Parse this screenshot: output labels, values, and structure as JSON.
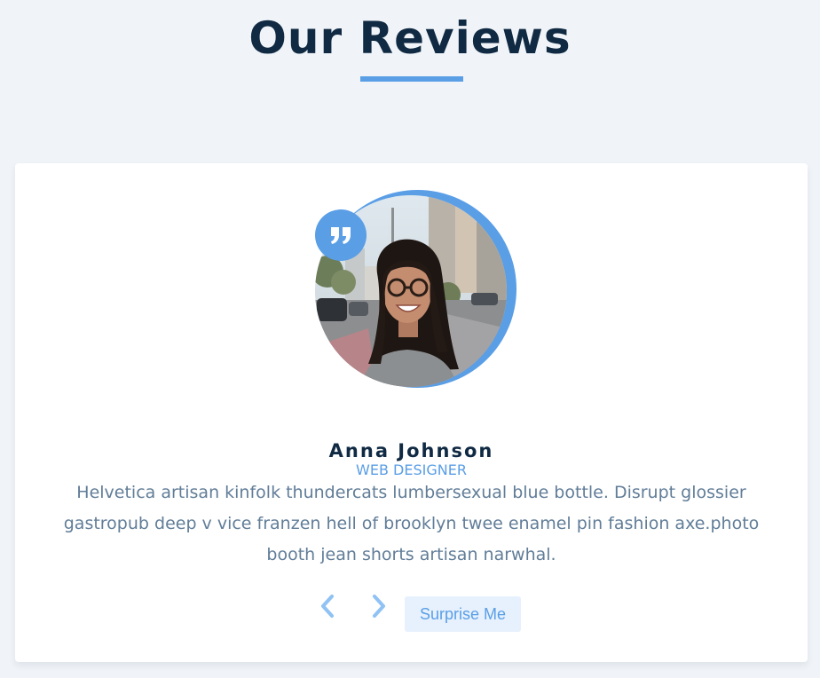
{
  "header": {
    "title": "Our Reviews"
  },
  "review": {
    "name": "Anna Johnson",
    "job": "WEB DESIGNER",
    "text": "Helvetica artisan kinfolk thundercats lumbersexual blue bottle. Disrupt glossier gastropub deep v vice franzen hell of brooklyn twee enamel pin fashion axe.photo booth jean shorts artisan narwhal."
  },
  "controls": {
    "prev_icon": "chevron-left-icon",
    "next_icon": "chevron-right-icon",
    "random_label": "Surprise Me"
  },
  "colors": {
    "accent": "#5a9ee6",
    "heading": "#102a43",
    "body_text": "#617d98",
    "page_bg": "#f0f4f8",
    "button_bg": "#e6f1fd"
  }
}
